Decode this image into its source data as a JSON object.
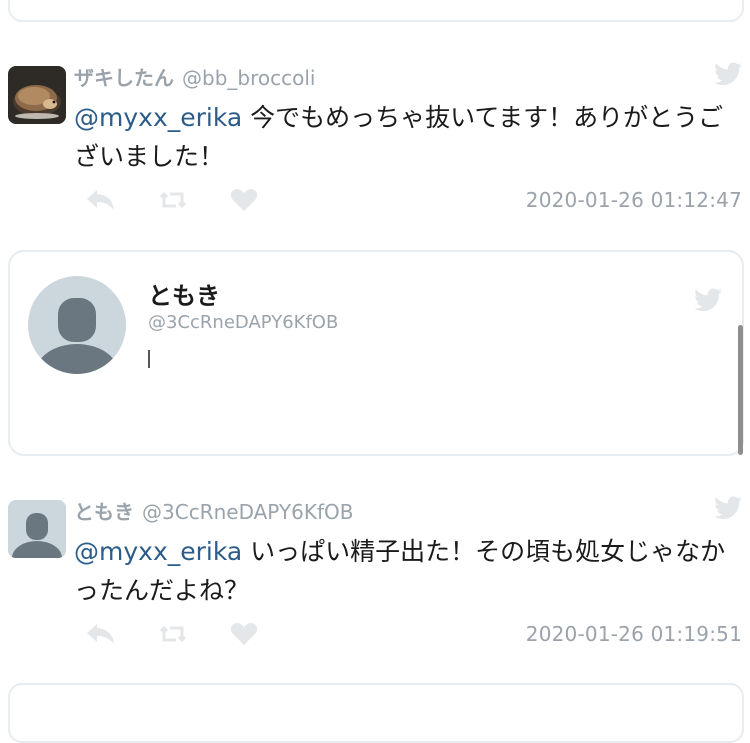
{
  "tweets": [
    {
      "display_name": "ザキしたん",
      "handle": "@bb_broccoli",
      "mention": "@myxx_erika",
      "text": " 今でもめっちゃ抜いてます！ありがとうございました！",
      "timestamp": "2020-01-26 01:12:47"
    },
    {
      "display_name": "ともき",
      "handle": "@3CcRneDAPY6KfOB",
      "mention": "@myxx_erika",
      "text": " いっぱい精子出た！その頃も処女じゃなかったんだよね？",
      "timestamp": "2020-01-26 01:19:51"
    }
  ],
  "compose": {
    "display_name": "ともき",
    "handle": "@3CcRneDAPY6KfOB"
  },
  "colors": {
    "mention": "#2b5c8a",
    "meta_gray": "#9aa3ab",
    "icon_gray": "#e3e7ea",
    "border": "#e6ecf0",
    "default_avatar_bg": "#ccd6dd",
    "default_avatar_fg": "#6a7781"
  },
  "icons": [
    "twitter-bird-icon",
    "reply-icon",
    "retweet-icon",
    "like-heart-icon",
    "default-avatar-icon",
    "hedgehog-avatar"
  ]
}
